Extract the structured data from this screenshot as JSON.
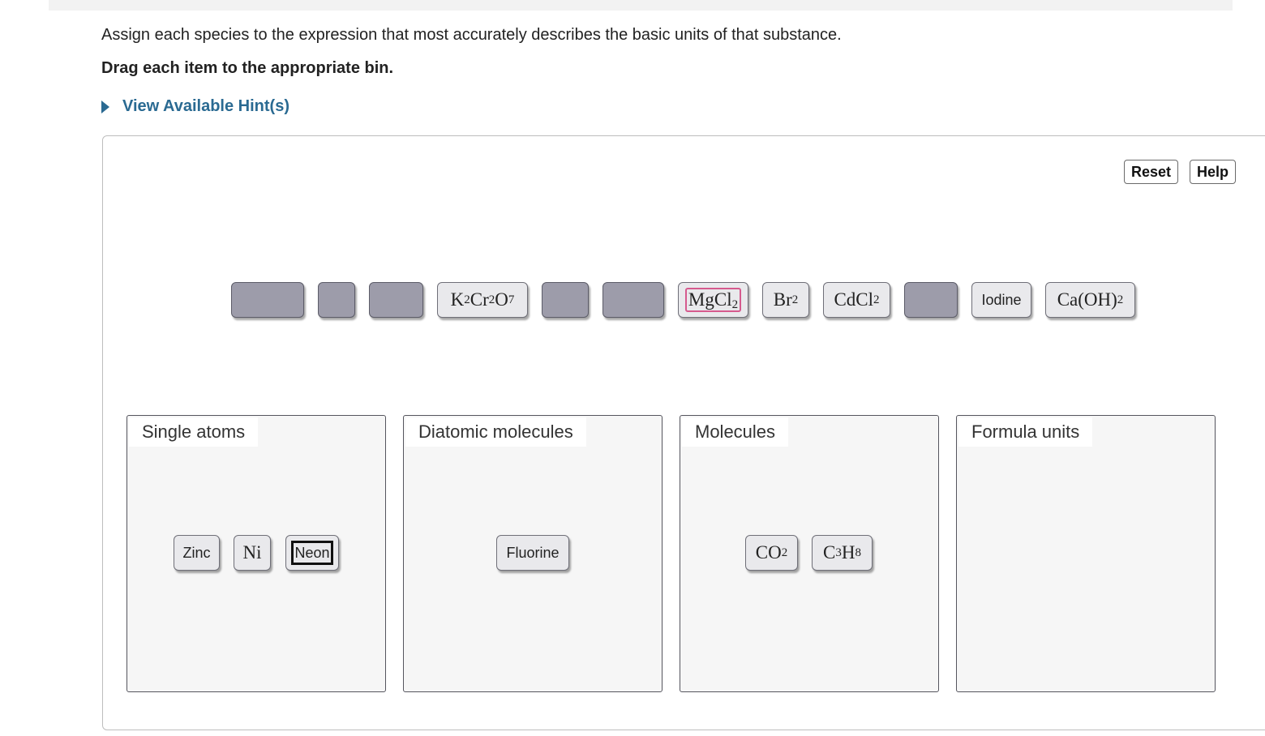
{
  "instructions": {
    "text": "Assign each species to the expression that most accurately describes the basic units of that substance.",
    "drag_text": "Drag each item to the appropriate bin."
  },
  "hint": {
    "label": "View Available Hint(s)"
  },
  "toolbar": {
    "reset_label": "Reset",
    "help_label": "Help"
  },
  "pool": {
    "k2cr2o7": {
      "base": [
        "K",
        "Cr",
        "O"
      ],
      "subs": [
        "2",
        "2",
        "7"
      ]
    },
    "mgcl2": {
      "base": [
        "MgCl"
      ],
      "subs": [
        "2"
      ]
    },
    "br2": {
      "base": [
        "Br"
      ],
      "subs": [
        "2"
      ]
    },
    "cdcl2": {
      "base": [
        "CdCl"
      ],
      "subs": [
        "2"
      ]
    },
    "iodine": "Iodine",
    "caoh2": {
      "base": "Ca(OH)",
      "sub": "2"
    }
  },
  "bins": {
    "single_atoms": {
      "title": "Single atoms",
      "items": {
        "zinc": "Zinc",
        "ni": "Ni",
        "neon": "Neon"
      }
    },
    "diatomic": {
      "title": "Diatomic molecules",
      "items": {
        "fluorine": "Fluorine"
      }
    },
    "molecules": {
      "title": "Molecules",
      "items": {
        "co2": {
          "base": "CO",
          "sub": "2"
        },
        "c3h8": {
          "base": [
            "C",
            "H"
          ],
          "subs": [
            "3",
            "8"
          ]
        }
      }
    },
    "formula_units": {
      "title": "Formula units"
    }
  },
  "colors": {
    "hint_link": "#2a6a92",
    "empty_slot": "#9d9caa",
    "tile_bg": "#e9e9ec",
    "selected_pink": "#d65a8e"
  }
}
